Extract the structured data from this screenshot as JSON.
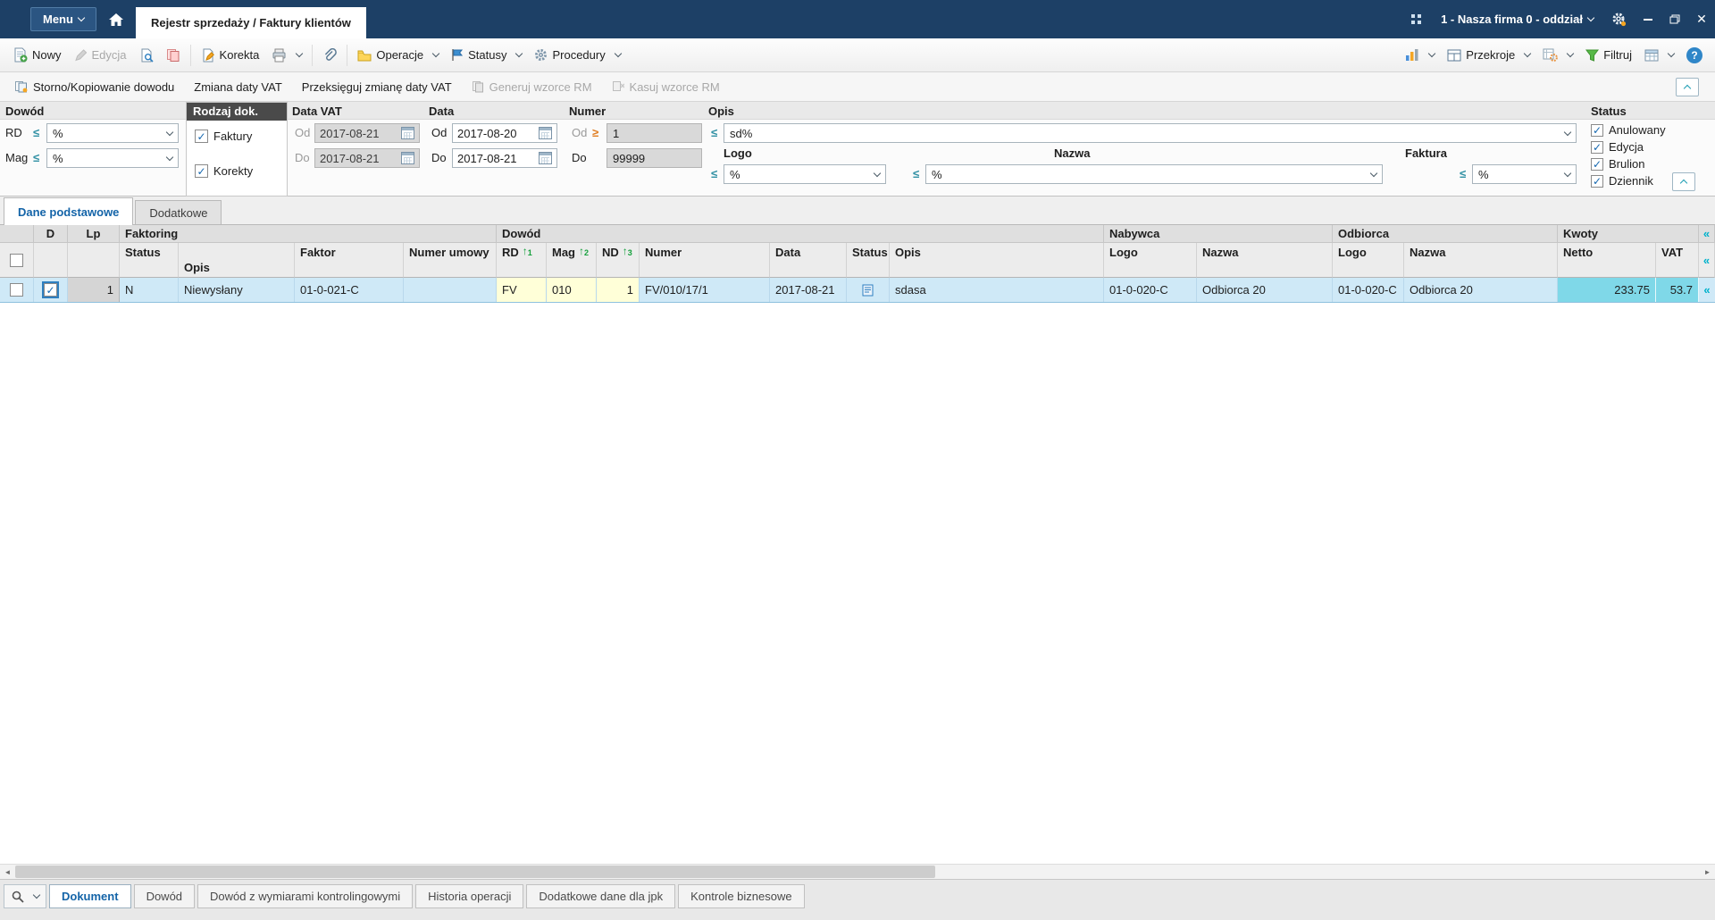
{
  "titlebar": {
    "menu": "Menu",
    "document_tab": "Rejestr sprzedaży / Faktury klientów",
    "company": "1 - Nasza firma 0 - oddział"
  },
  "toolbar": {
    "nowy": "Nowy",
    "edycja": "Edycja",
    "korekta": "Korekta",
    "operacje": "Operacje",
    "statusy": "Statusy",
    "procedury": "Procedury",
    "przekroje": "Przekroje",
    "filtruj": "Filtruj"
  },
  "actions": {
    "storno": "Storno/Kopiowanie dowodu",
    "zmiana_daty_vat": "Zmiana daty VAT",
    "przeksieguj": "Przeksięguj zmianę daty VAT",
    "generuj_wzorce": "Generuj wzorce RM",
    "kasuj_wzorce": "Kasuj wzorce RM"
  },
  "filters": {
    "sections": {
      "dowod": "Dowód",
      "rodzaj_dok": "Rodzaj dok.",
      "data_vat": "Data VAT",
      "data": "Data",
      "numer": "Numer",
      "opis": "Opis",
      "logo": "Logo",
      "nazwa": "Nazwa",
      "faktura": "Faktura",
      "status": "Status"
    },
    "operators": {
      "like": "≤",
      "gte": "≥"
    },
    "labels": {
      "rd": "RD",
      "mag": "Mag",
      "od": "Od",
      "do": "Do"
    },
    "values": {
      "rd": "%",
      "mag": "%",
      "data_vat_od": "2017-08-21",
      "data_vat_do": "2017-08-21",
      "data_od": "2017-08-20",
      "data_do": "2017-08-21",
      "numer_od": "1",
      "numer_do": "99999",
      "opis": "sd%",
      "logo": "%",
      "nazwa": "%",
      "faktura": "%"
    },
    "doc_types": [
      "Faktury",
      "Korekty"
    ],
    "status_items": [
      "Anulowany",
      "Edycja",
      "Brulion",
      "Dziennik"
    ]
  },
  "tabs": {
    "dane_podstawowe": "Dane podstawowe",
    "dodatkowe": "Dodatkowe"
  },
  "grid": {
    "groups": {
      "d": "D",
      "lp": "Lp",
      "faktoring": "Faktoring",
      "dowod": "Dowód",
      "nabywca": "Nabywca",
      "odbiorca": "Odbiorca",
      "kwoty": "Kwoty"
    },
    "columns": {
      "status_faktoring": "Status",
      "opis_faktoring": "Opis",
      "faktor": "Faktor",
      "numer_umowy": "Numer umowy",
      "rd": "RD",
      "mag": "Mag",
      "nd": "ND",
      "numer": "Numer",
      "data": "Data",
      "status_dowod": "Status",
      "opis_dowod": "Opis",
      "logo_nabywca": "Logo",
      "nazwa_nabywca": "Nazwa",
      "logo_odbiorca": "Logo",
      "nazwa_odbiorca": "Nazwa",
      "netto": "Netto",
      "vat": "VAT"
    },
    "sort_indicators": {
      "rd": "1",
      "mag": "2",
      "nd": "3"
    },
    "rows": [
      {
        "lp": "1",
        "status_faktoring": "N",
        "opis_faktoring": "Niewysłany",
        "faktor": "01-0-021-C",
        "numer_umowy": "",
        "rd": "FV",
        "mag": "010",
        "nd": "1",
        "numer": "FV/010/17/1",
        "data": "2017-08-21",
        "opis_dowod": "sdasa",
        "logo_nabywca": "01-0-020-C",
        "nazwa_nabywca": "Odbiorca 20",
        "logo_odbiorca": "01-0-020-C",
        "nazwa_odbiorca": "Odbiorca 20",
        "netto": "233.75",
        "vat": "53.7"
      }
    ]
  },
  "bottom": {
    "tabs": [
      "Dokument",
      "Dowód",
      "Dowód z wymiarami kontrolingowymi",
      "Historia operacji",
      "Dodatkowe dane dla jpk",
      "Kontrole biznesowe"
    ]
  },
  "icons": {
    "close": "✕",
    "help": "?",
    "collapse": "«",
    "scroll_left": "◄",
    "scroll_right": "►"
  }
}
